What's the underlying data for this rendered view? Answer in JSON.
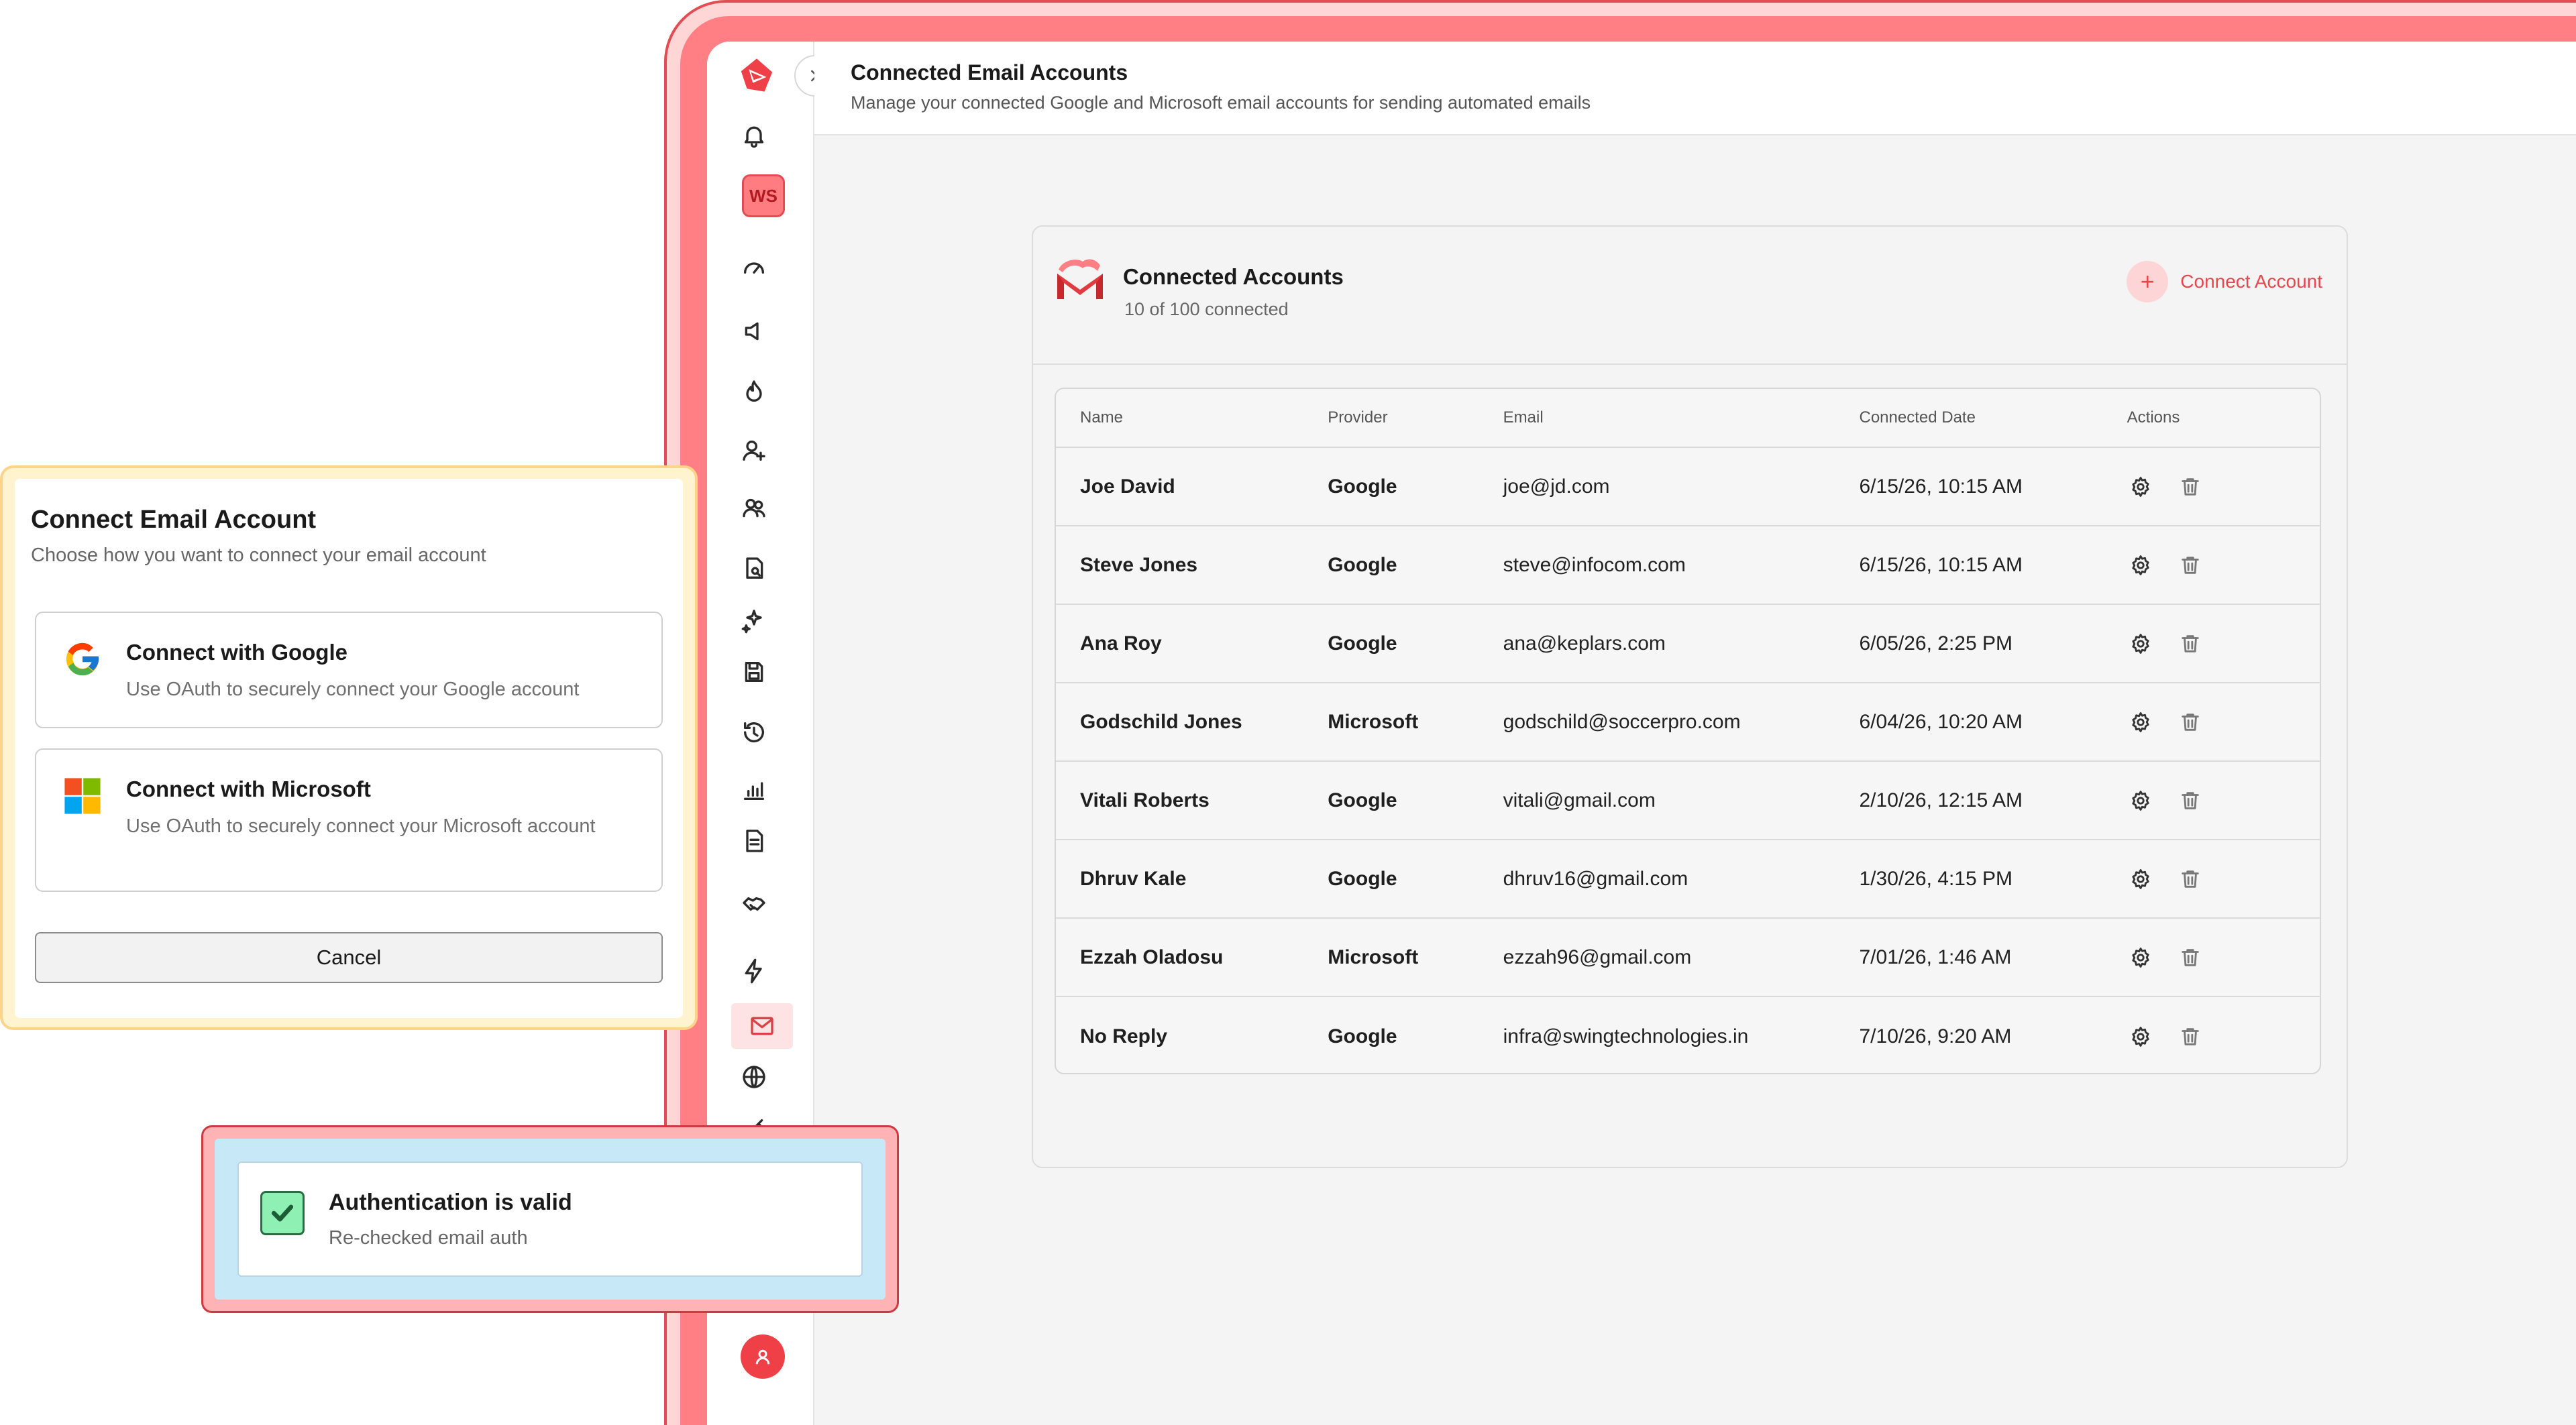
{
  "header": {
    "title": "Connected Email Accounts",
    "subtitle": "Manage your connected Google and Microsoft email accounts for sending automated emails"
  },
  "sidebar": {
    "workspace_badge": "WS",
    "items": [
      {
        "icon": "bell-icon"
      },
      {
        "icon": "speedometer-icon"
      },
      {
        "icon": "megaphone-icon"
      },
      {
        "icon": "flame-icon"
      },
      {
        "icon": "user-add-icon"
      },
      {
        "icon": "users-icon"
      },
      {
        "icon": "document-search-icon"
      },
      {
        "icon": "sparkles-icon"
      },
      {
        "icon": "save-icon"
      },
      {
        "icon": "history-icon"
      },
      {
        "icon": "analytics-icon"
      },
      {
        "icon": "file-text-icon"
      },
      {
        "icon": "handshake-icon"
      },
      {
        "icon": "lightning-icon"
      },
      {
        "icon": "mail-icon",
        "active": true
      },
      {
        "icon": "globe-icon"
      },
      {
        "icon": "key-icon"
      }
    ]
  },
  "card": {
    "title": "Connected Accounts",
    "count": "10 of 100 connected",
    "connect_label": "Connect Account"
  },
  "table": {
    "columns": [
      "Name",
      "Provider",
      "Email",
      "Connected Date",
      "Actions"
    ],
    "rows": [
      {
        "name": "Joe David",
        "provider": "Google",
        "email": "joe@jd.com",
        "date": "6/15/26,  10:15 AM"
      },
      {
        "name": "Steve Jones",
        "provider": "Google",
        "email": "steve@infocom.com",
        "date": "6/15/26,  10:15 AM"
      },
      {
        "name": "Ana Roy",
        "provider": "Google",
        "email": "ana@keplars.com",
        "date": "6/05/26,  2:25 PM"
      },
      {
        "name": "Godschild Jones",
        "provider": "Microsoft",
        "email": "godschild@soccerpro.com",
        "date": "6/04/26,  10:20 AM"
      },
      {
        "name": "Vitali Roberts",
        "provider": "Google",
        "email": "vitali@gmail.com",
        "date": "2/10/26,  12:15 AM"
      },
      {
        "name": "Dhruv Kale",
        "provider": "Google",
        "email": "dhruv16@gmail.com",
        "date": "1/30/26,  4:15 PM"
      },
      {
        "name": "Ezzah Oladosu",
        "provider": "Microsoft",
        "email": "ezzah96@gmail.com",
        "date": "7/01/26,  1:46 AM"
      },
      {
        "name": "No Reply",
        "provider": "Google",
        "email": "infra@swingtechnologies.in",
        "date": "7/10/26,  9:20 AM"
      }
    ]
  },
  "modal": {
    "title": "Connect Email Account",
    "subtitle": "Choose how you want to connect your email account",
    "google_title": "Connect with Google",
    "google_desc": "Use OAuth to securely connect your Google account",
    "microsoft_title": "Connect with Microsoft",
    "microsoft_desc": "Use OAuth to securely connect your Microsoft account",
    "cancel_label": "Cancel"
  },
  "toast": {
    "title": "Authentication is valid",
    "subtitle": "Re-checked email auth"
  },
  "colors": {
    "accent": "#e8464c",
    "frame": "#ff7f84",
    "success": "#8ff0b4"
  }
}
